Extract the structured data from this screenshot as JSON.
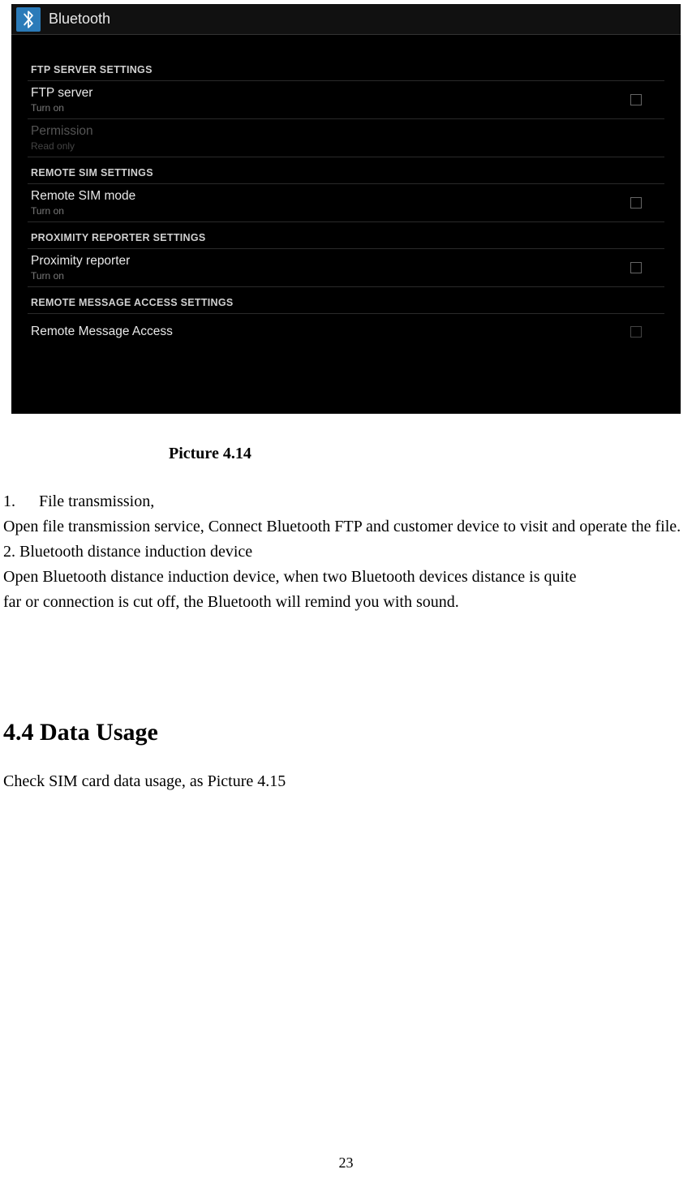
{
  "screenshot": {
    "title": "Bluetooth",
    "sections": {
      "ftp": {
        "header": "FTP SERVER SETTINGS",
        "server_title": "FTP server",
        "server_sub": "Turn on",
        "perm_title": "Permission",
        "perm_sub": "Read only"
      },
      "sim": {
        "header": "REMOTE SIM SETTINGS",
        "title": "Remote SIM mode",
        "sub": "Turn on"
      },
      "prox": {
        "header": "PROXIMITY REPORTER SETTINGS",
        "title": "Proximity reporter",
        "sub": "Turn on"
      },
      "msg": {
        "header": "REMOTE MESSAGE ACCESS SETTINGS",
        "title": "Remote Message Access"
      }
    }
  },
  "caption": "Picture 4.14",
  "body": {
    "item1_num": "1.",
    "item1_title": "File transmission,",
    "item1_body": "Open file transmission service, Connect Bluetooth FTP and customer device to visit and operate the file.",
    "item2_title": "2. Bluetooth distance induction device",
    "item2_line1": "Open Bluetooth distance induction device, when two Bluetooth devices distance is  quite",
    "item2_line2": "far or connection is cut off, the Bluetooth will remind you with sound."
  },
  "section_heading": "4.4 Data Usage",
  "section_text": "Check SIM card data usage, as Picture 4.15",
  "page_number": "23"
}
